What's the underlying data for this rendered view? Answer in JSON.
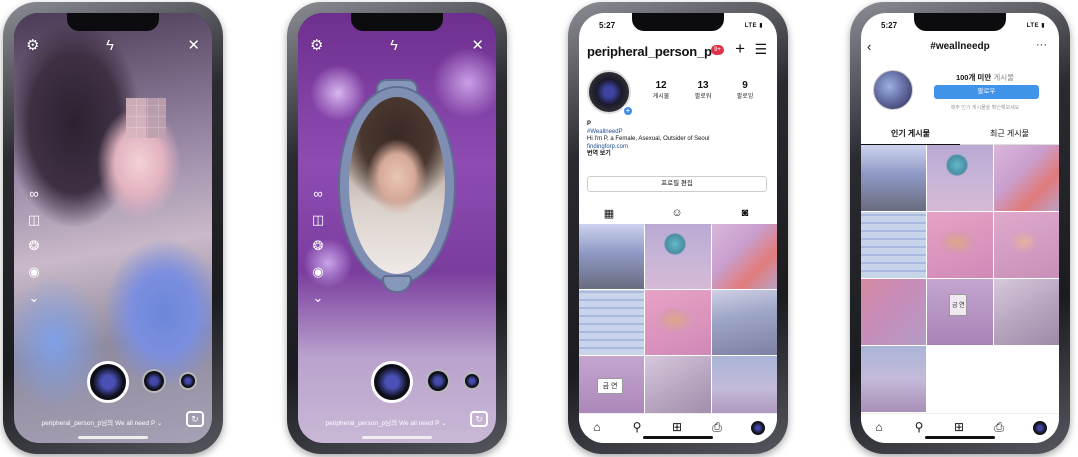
{
  "camera": {
    "left": {
      "username_line": "peripheral_person_p님의 We all need P ⌄"
    },
    "right": {
      "username_line": "peripheral_person_p님의 We all need P ⌄"
    },
    "top_icons": [
      "settings-icon",
      "flash-off-icon",
      "close-icon"
    ],
    "side_tools": [
      "infinity-icon",
      "layout-icon",
      "boomerang-icon",
      "record-icon",
      "chevron-down-icon"
    ]
  },
  "profile": {
    "time": "5:27",
    "signal": "LTE",
    "username": "peripheral_person_p",
    "notif_count": "9+",
    "stats": [
      {
        "value": "12",
        "label": "게시물"
      },
      {
        "value": "13",
        "label": "팔로워"
      },
      {
        "value": "9",
        "label": "팔로잉"
      }
    ],
    "bio": {
      "name": "P",
      "hashtag": "#WeallneedP",
      "line": "Hi I'm P, a Female, Asexual, Outsider of Seoul",
      "link": "findingforp.com",
      "translate": "번역 보기"
    },
    "edit_button": "프로필 편집",
    "grid_sign": "금 연"
  },
  "hashtag": {
    "time": "5:27",
    "signal": "LTE",
    "title": "#weallneedp",
    "count_text": "100개 미만",
    "count_sub": "게시물",
    "follow_button": "팔로우",
    "note": "매주 인기 게시물을 확인해보세요",
    "tabs": [
      "인기 게시물",
      "최근 게시물"
    ],
    "grid_sign": "금 연"
  },
  "colors": {
    "follow_blue": "#3f93e8",
    "badge_red": "#e0314a",
    "tag_blue": "#1c4b8f"
  }
}
